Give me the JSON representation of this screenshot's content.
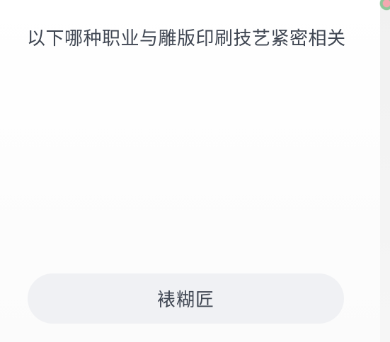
{
  "quiz": {
    "question": "以下哪种职业与雕版印刷技艺紧密相关",
    "options": [
      {
        "label": "裱糊匠"
      }
    ]
  },
  "colors": {
    "text": "#3f4652",
    "option_background": "#f0f1f4",
    "page_background": "#ffffff"
  }
}
